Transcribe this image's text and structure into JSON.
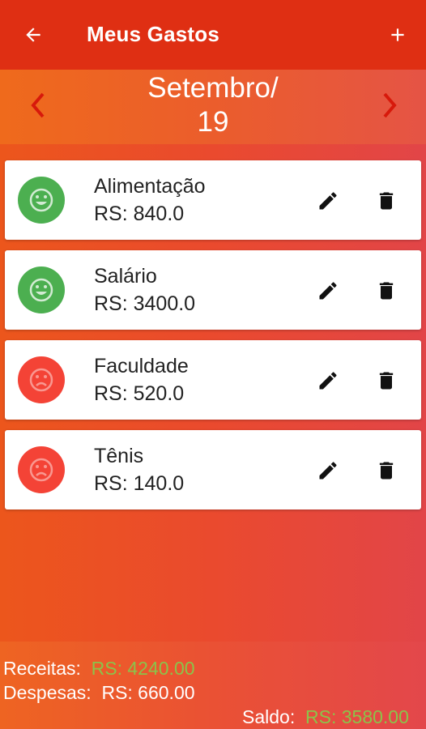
{
  "appbar": {
    "title": "Meus Gastos",
    "back_icon": "arrow-left-icon",
    "add_icon": "plus-icon"
  },
  "month_nav": {
    "line1": "Setembro/",
    "line2": "19",
    "prev_icon": "chevron-left-icon",
    "next_icon": "chevron-right-icon",
    "arrow_color": "#d7190b"
  },
  "entries": [
    {
      "name": "Alimentação",
      "amount": "RS: 840.0",
      "type": "income",
      "status_icon": "happy-face-icon",
      "color": "#4caf50"
    },
    {
      "name": "Salário",
      "amount": "RS: 3400.0",
      "type": "income",
      "status_icon": "happy-face-icon",
      "color": "#4caf50"
    },
    {
      "name": "Faculdade",
      "amount": "RS: 520.0",
      "type": "expense",
      "status_icon": "sad-face-icon",
      "color": "#f44336"
    },
    {
      "name": "Tênis",
      "amount": "RS: 140.0",
      "type": "expense",
      "status_icon": "sad-face-icon",
      "color": "#f44336"
    }
  ],
  "summary": {
    "income_label": "Receitas:",
    "income_value": "RS: 4240.00",
    "expense_label": "Despesas:",
    "expense_value": "RS: 660.00",
    "balance_label": "Saldo:",
    "balance_value": "RS: 3580.00",
    "positive_color": "#8bc34a"
  }
}
